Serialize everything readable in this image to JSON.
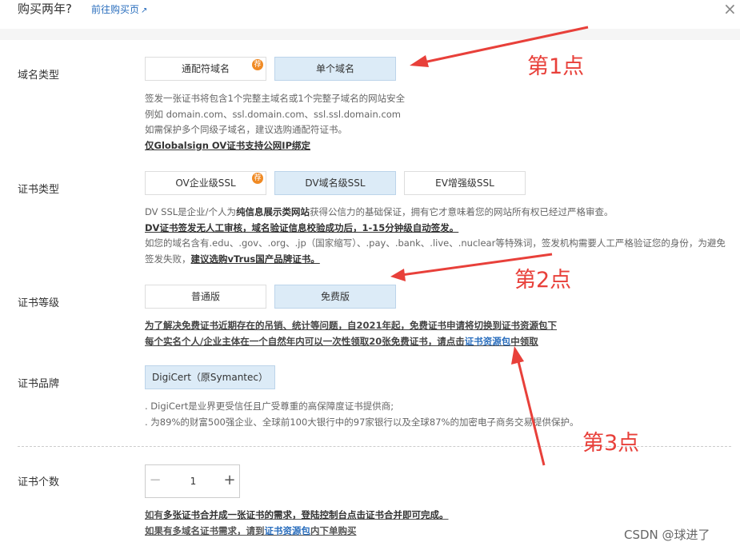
{
  "header": {
    "title": "购买两年?",
    "link": "前往购买页",
    "ext_icon": "↗"
  },
  "domain_type": {
    "label": "域名类型",
    "options": [
      {
        "label": "通配符域名",
        "badge": "荐"
      },
      {
        "label": "单个域名"
      }
    ],
    "desc": [
      "签发一张证书将包含1个完整主域名或1个完整子域名的网站安全",
      "例如 domain.com、ssl.domain.com、ssl.ssl.domain.com",
      "如需保护多个同级子域名，建议选购通配符证书。"
    ],
    "note": "仅Globalsign OV证书支持公网IP绑定"
  },
  "cert_type": {
    "label": "证书类型",
    "options": [
      {
        "label": "OV企业级SSL",
        "badge": "荐"
      },
      {
        "label": "DV域名级SSL"
      },
      {
        "label": "EV增强级SSL"
      }
    ],
    "desc1_prefix": "DV SSL是企业/个人为",
    "desc1_bold": "纯信息展示类网站",
    "desc1_suffix": "获得公信力的基础保证，拥有它才意味着您的网站所有权已经过严格审查。",
    "desc2": "DV证书签发无人工审核，域名验证信息校验成功后，1-15分钟级自动签发。",
    "desc3": "如您的域名含有.edu、.gov、.org、.jp（国家缩写）、.pay、.bank、.live、.nuclear等特殊词，签发机构需要人工严格验证您的身份，为避免",
    "desc4_prefix": "签发失败，",
    "desc4_bold": "建议选购vTrus国产品牌证书。"
  },
  "cert_level": {
    "label": "证书等级",
    "options": [
      {
        "label": "普通版"
      },
      {
        "label": "免费版"
      }
    ],
    "note1": "为了解决免费证书近期存在的吊销、统计等问题，自2021年起，免费证书申请将切换到证书资源包下",
    "note2_prefix": "每个实名个人/企业主体在一个自然年内可以一次性领取20张免费证书，请点击",
    "note2_link": "证书资源包",
    "note2_suffix": "中领取"
  },
  "cert_brand": {
    "label": "证书品牌",
    "option": "DigiCert（原Symantec）",
    "desc": [
      ". DigiCert是业界更受信任且广受尊重的高保障度证书提供商;",
      ". 为89%的财富500强企业、全球前100大银行中的97家银行以及全球87%的加密电子商务交易提供保护。"
    ]
  },
  "cert_count": {
    "label": "证书个数",
    "minus": "−",
    "value": "1",
    "plus": "+",
    "note1_prefix": "如有",
    "note1_bold": "多张证书合并成一张证书的需求，登陆控制台点击证书合并即可完成。",
    "note2_prefix": "如果有多域名证书需求，请到",
    "note2_link": "证书资源包",
    "note2_suffix": "内下单购买"
  },
  "annotations": {
    "a1": "第1点",
    "a2": "第2点",
    "a3": "第3点",
    "color": "#e8403a"
  },
  "watermark": "CSDN @球进了",
  "icons": {
    "close": "×"
  }
}
